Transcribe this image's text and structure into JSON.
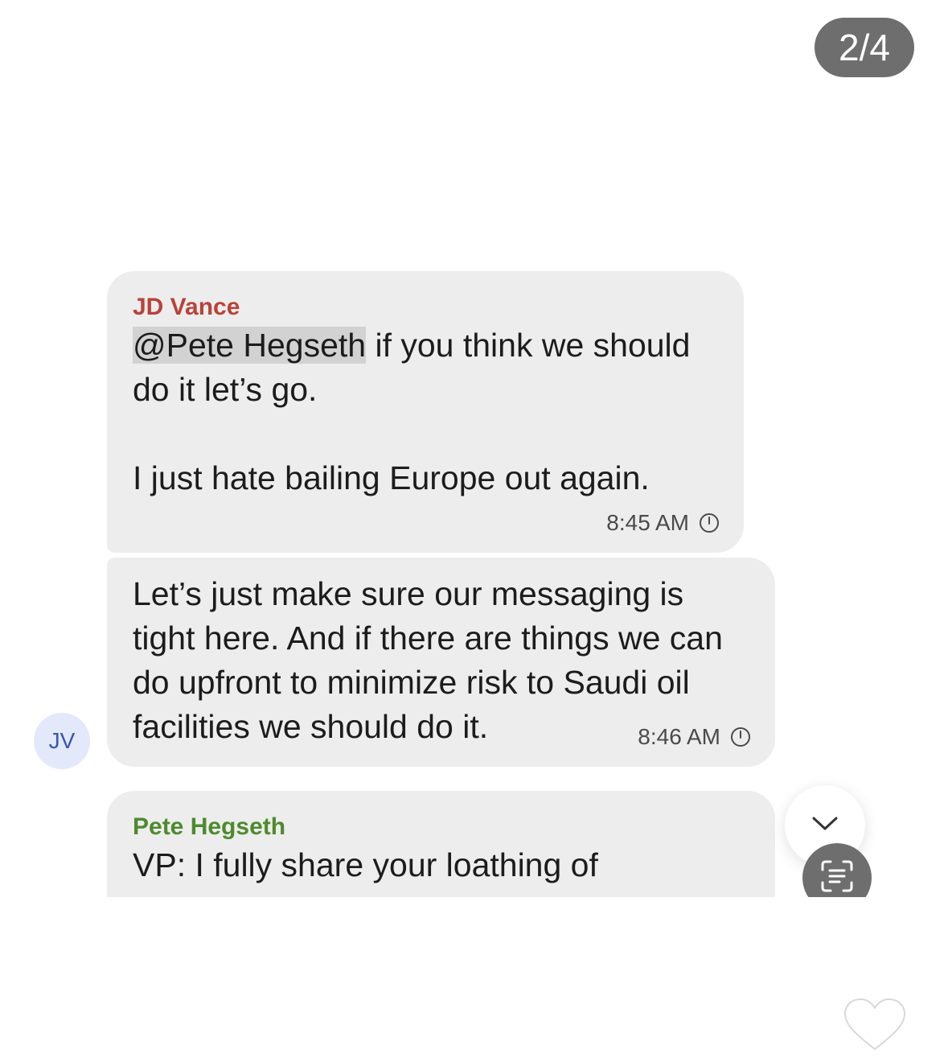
{
  "viewer": {
    "page_counter": "2/4"
  },
  "messages": [
    {
      "sender": "JD Vance",
      "mention": "@Pete Hegseth",
      "text_line1_rest": " if you think we should",
      "text_line2": "do it let’s go.",
      "text_line3": "I just hate bailing Europe out again.",
      "time": "8:45 AM"
    },
    {
      "lines": [
        "Let’s just make sure our messaging is",
        "tight here. And if there are things we can",
        "do upfront to minimize risk to Saudi oil",
        "facilities we should do it."
      ],
      "time": "8:46 AM"
    },
    {
      "sender": "Pete Hegseth",
      "lines": [
        "VP: I fully share your loathing of"
      ]
    }
  ],
  "avatar": {
    "initials": "JV"
  },
  "icons": {
    "timer": "timer-icon",
    "scroll_down": "chevron-down-icon",
    "scan": "text-scan-icon",
    "like": "heart-icon"
  },
  "colors": {
    "bubble": "#ededed",
    "vance_name": "#b8433a",
    "hegseth_name": "#4e8a2d",
    "avatar_bg": "#e3e8fb",
    "avatar_text": "#3a56b0"
  }
}
